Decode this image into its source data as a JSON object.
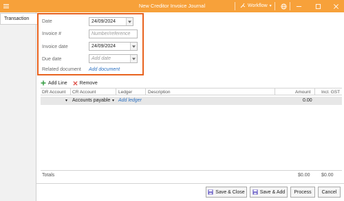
{
  "window": {
    "title": "New Creditor Invoice Journal",
    "workflow_label": "Workflow",
    "accent_color": "#f7a13a"
  },
  "tabs": [
    {
      "label": "Transaction",
      "selected": true
    }
  ],
  "form": {
    "date": {
      "label": "Date",
      "value": "24/09/2024"
    },
    "invoice_number": {
      "label": "Invoice #",
      "placeholder": "Number/reference"
    },
    "invoice_date": {
      "label": "Invoice date",
      "value": "24/09/2024"
    },
    "due_date": {
      "label": "Due date",
      "placeholder": "Add date"
    },
    "related_document": {
      "label": "Related document",
      "link": "Add document"
    }
  },
  "line_toolbar": {
    "add_line": "Add Line",
    "remove": "Remove"
  },
  "grid": {
    "columns": [
      "DR Account",
      "CR Account",
      "Ledger",
      "Description",
      "Amount",
      "Incl. GST"
    ],
    "rows": [
      {
        "cr_account": "Accounts payable",
        "ledger_link": "Add ledger",
        "amount": "0.00"
      }
    ],
    "totals": {
      "label": "Totals",
      "amount": "$0.00",
      "incl_gst": "$0.00"
    }
  },
  "footer": {
    "save_close": "Save & Close",
    "save_add": "Save & Add",
    "process": "Process",
    "cancel": "Cancel"
  }
}
